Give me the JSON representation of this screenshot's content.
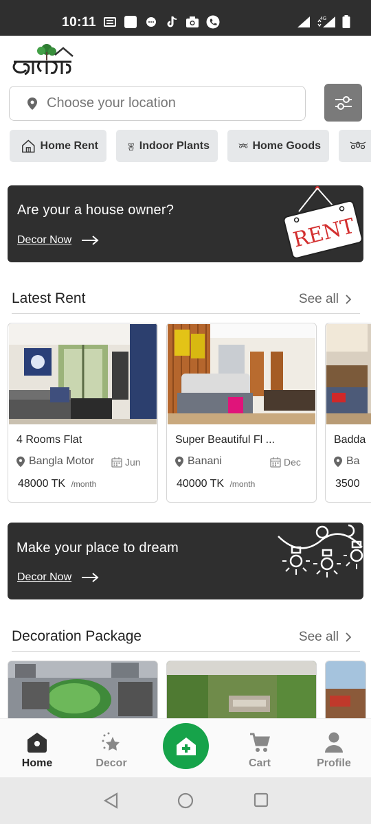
{
  "status_bar": {
    "time": "10:11",
    "network": "4G"
  },
  "app": {
    "logo_text": "ভাড়াদিব"
  },
  "search": {
    "placeholder": "Choose your location"
  },
  "categories": [
    {
      "label": "Home Rent",
      "icon": "house-icon"
    },
    {
      "label": "Indoor Plants",
      "icon": "plant-icon"
    },
    {
      "label": "Home Goods",
      "icon": "lights-icon"
    },
    {
      "label": "",
      "icon": "lights-icon"
    }
  ],
  "banner_owner": {
    "title": "Are your a house owner?",
    "cta": "Decor Now",
    "sign_text": "RENT"
  },
  "latest_rent": {
    "title": "Latest Rent",
    "see_all": "See all",
    "items": [
      {
        "title": "4 Rooms Flat",
        "location": "Bangla Motor",
        "date": "Jun",
        "price": "48000",
        "currency": "TK",
        "unit": "/month"
      },
      {
        "title": "Super Beautiful Fl ...",
        "location": "Banani",
        "date": "Dec",
        "price": "40000",
        "currency": "TK",
        "unit": "/month"
      },
      {
        "title": "Badda",
        "location": "Ba",
        "date": "",
        "price": "3500",
        "currency": "",
        "unit": ""
      }
    ]
  },
  "banner_dream": {
    "title": "Make your place to dream",
    "cta": "Decor Now"
  },
  "decoration": {
    "title": "Decoration Package",
    "see_all": "See all"
  },
  "bottom_nav": {
    "home": "Home",
    "decor": "Decor",
    "cart": "Cart",
    "profile": "Profile"
  },
  "colors": {
    "accent": "#16a34a",
    "dark_banner": "#2f2f2f",
    "chip_bg": "#e6e8ea"
  }
}
